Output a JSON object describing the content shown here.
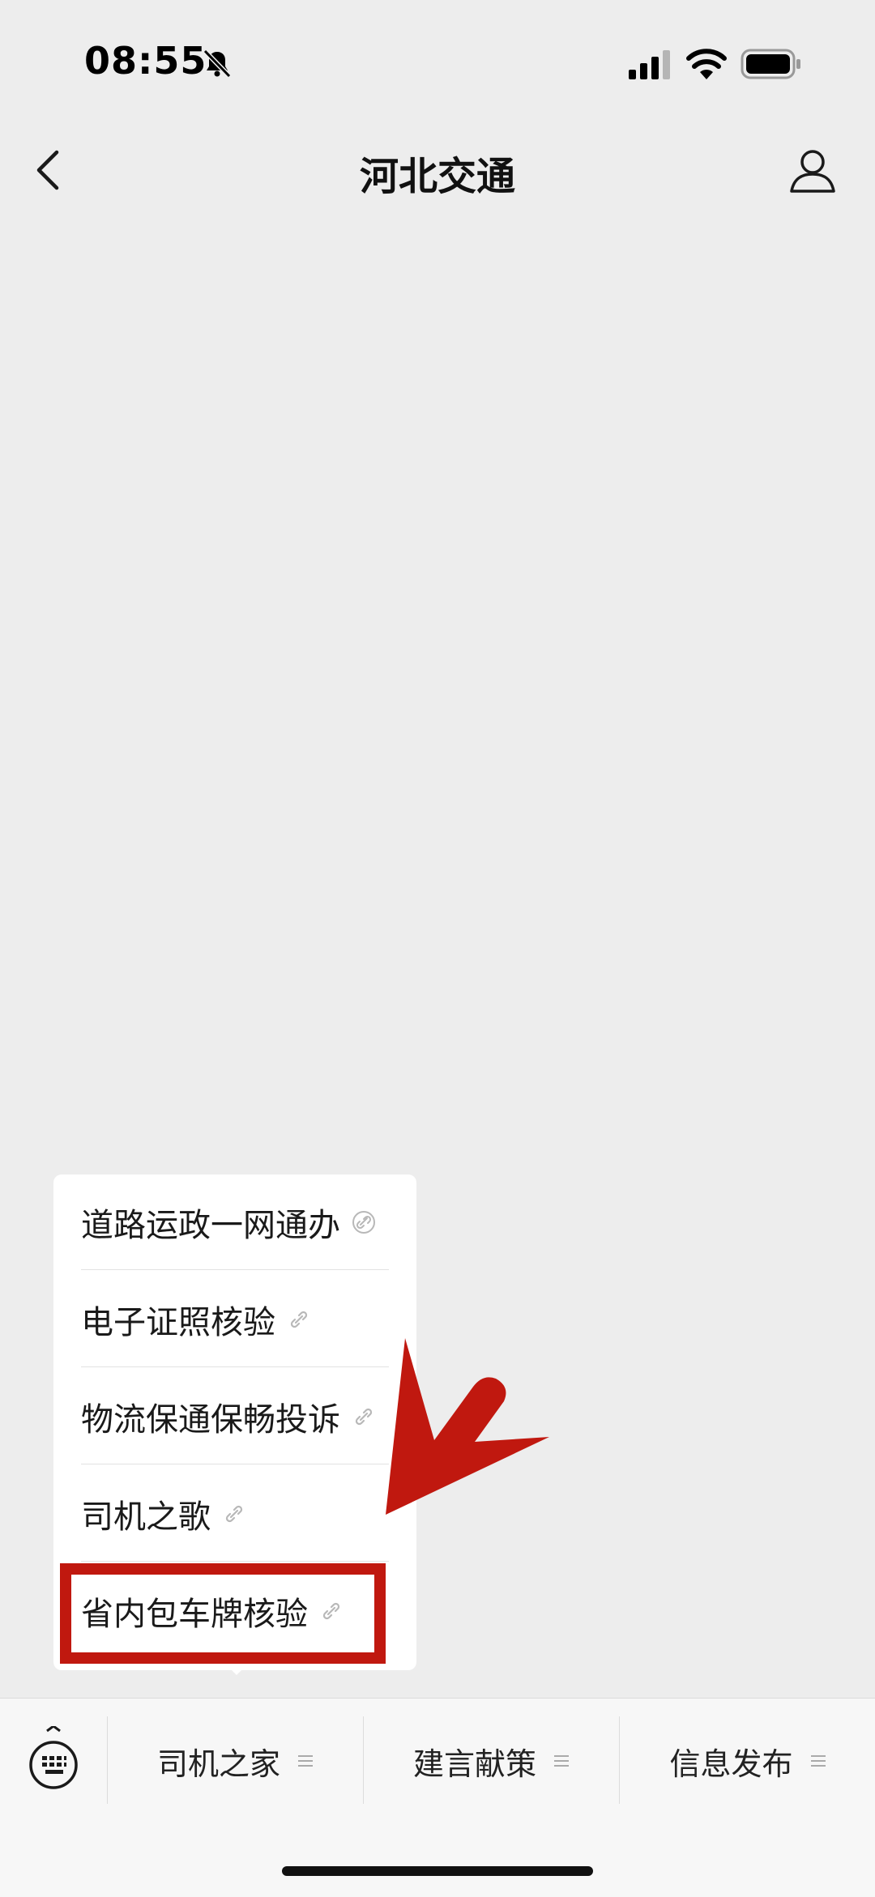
{
  "status_bar": {
    "time": "08:55"
  },
  "header": {
    "title": "河北交通"
  },
  "popup_menu": {
    "items": [
      {
        "label": "道路运政一网通办"
      },
      {
        "label": "电子证照核验"
      },
      {
        "label": "物流保通保畅投诉"
      },
      {
        "label": "司机之歌"
      },
      {
        "label": "省内包车牌核验"
      }
    ]
  },
  "bottom_nav": {
    "tabs": [
      {
        "label": "司机之家"
      },
      {
        "label": "建言献策"
      },
      {
        "label": "信息发布"
      }
    ]
  },
  "colors": {
    "annotation": "#c0180f",
    "background": "#ededed"
  }
}
